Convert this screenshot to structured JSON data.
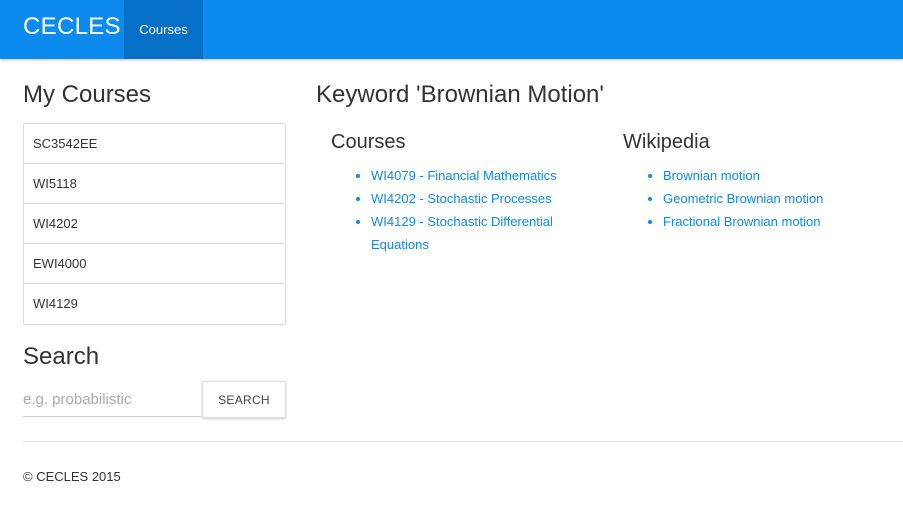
{
  "navbar": {
    "brand": "CECLES",
    "active_tab": "Courses"
  },
  "sidebar": {
    "title": "My Courses",
    "courses": [
      "SC3542EE",
      "WI5118",
      "WI4202",
      "EWI4000",
      "WI4129"
    ],
    "search": {
      "title": "Search",
      "placeholder": "e.g. probabilistic",
      "value": "",
      "button_label": "SEARCH"
    }
  },
  "main": {
    "title": "Keyword 'Brownian Motion'",
    "courses": {
      "heading": "Courses",
      "items": [
        "WI4079 - Financial Mathematics",
        "WI4202 - Stochastic Processes",
        "WI4129 - Stochastic Differential Equations"
      ]
    },
    "wikipedia": {
      "heading": "Wikipedia",
      "items": [
        "Brownian motion",
        "Geometric Brownian motion",
        "Fractional Brownian motion"
      ]
    }
  },
  "footer": {
    "text": "© CECLES 2015"
  },
  "colors": {
    "navbar": "#0d8aee",
    "navbar_active": "#0670c9",
    "link": "#0d8aee"
  }
}
